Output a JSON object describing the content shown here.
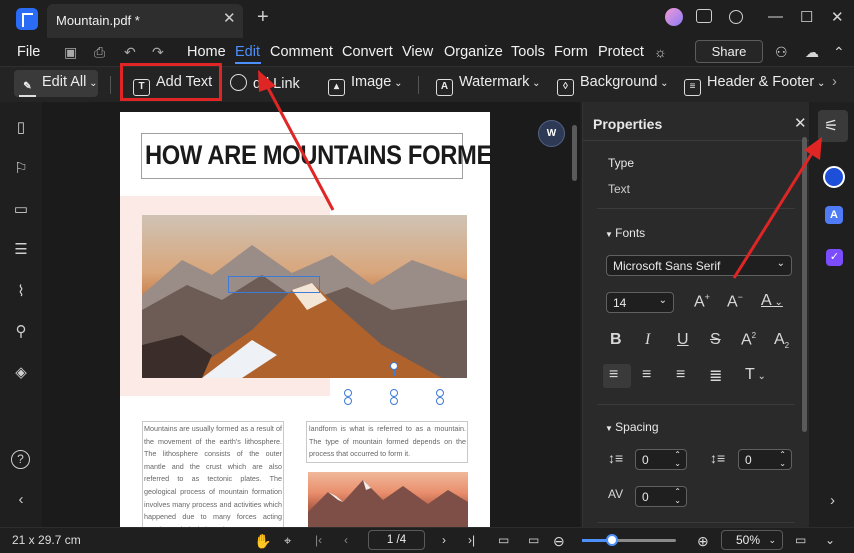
{
  "titlebar": {
    "tab_title": "Mountain.pdf *",
    "close": "✕",
    "new_tab": "+",
    "min": "—",
    "max": "☐",
    "win_close": "✕"
  },
  "menu": {
    "file": "File",
    "items": [
      "Home",
      "Edit",
      "Comment",
      "Convert",
      "View",
      "Organize",
      "Tools",
      "Form",
      "Protect"
    ],
    "share": "Share"
  },
  "toolbar": {
    "edit_all": "Edit All",
    "add_text": "Add Text",
    "add_link": "dd Link",
    "image": "Image",
    "watermark": "Watermark",
    "background": "Background",
    "header_footer": "Header & Footer"
  },
  "document": {
    "title": "HOW ARE MOUNTAINS FORMED?",
    "para_left": "Mountains are usually formed as a result of the movement of the earth's lithosphere. The lithosphere consists of the outer mantle and the crust which are also referred to as tectonic plates. The geological process of mountain formation involves many process and activities which happened due to many forces acting together or in isolation. The",
    "para_right": "landform is what is referred to as a mountain. The type of mountain formed depends on the process that occurred to form it."
  },
  "word_badge": "W",
  "properties": {
    "title": "Properties",
    "type_label": "Type",
    "type_value": "Text",
    "fonts_label": "Fonts",
    "font_family": "Microsoft Sans Serif",
    "font_size": "14",
    "spacing_label": "Spacing",
    "line_spacing": "0",
    "para_spacing": "0",
    "char_spacing": "0"
  },
  "status": {
    "page_size": "21 x 29.7 cm",
    "page": "1 /4",
    "zoom": "50%",
    "zoom_fraction": 0.32
  },
  "colors": {
    "accent": "#4d8ffb",
    "annotation_red": "#e02525"
  }
}
